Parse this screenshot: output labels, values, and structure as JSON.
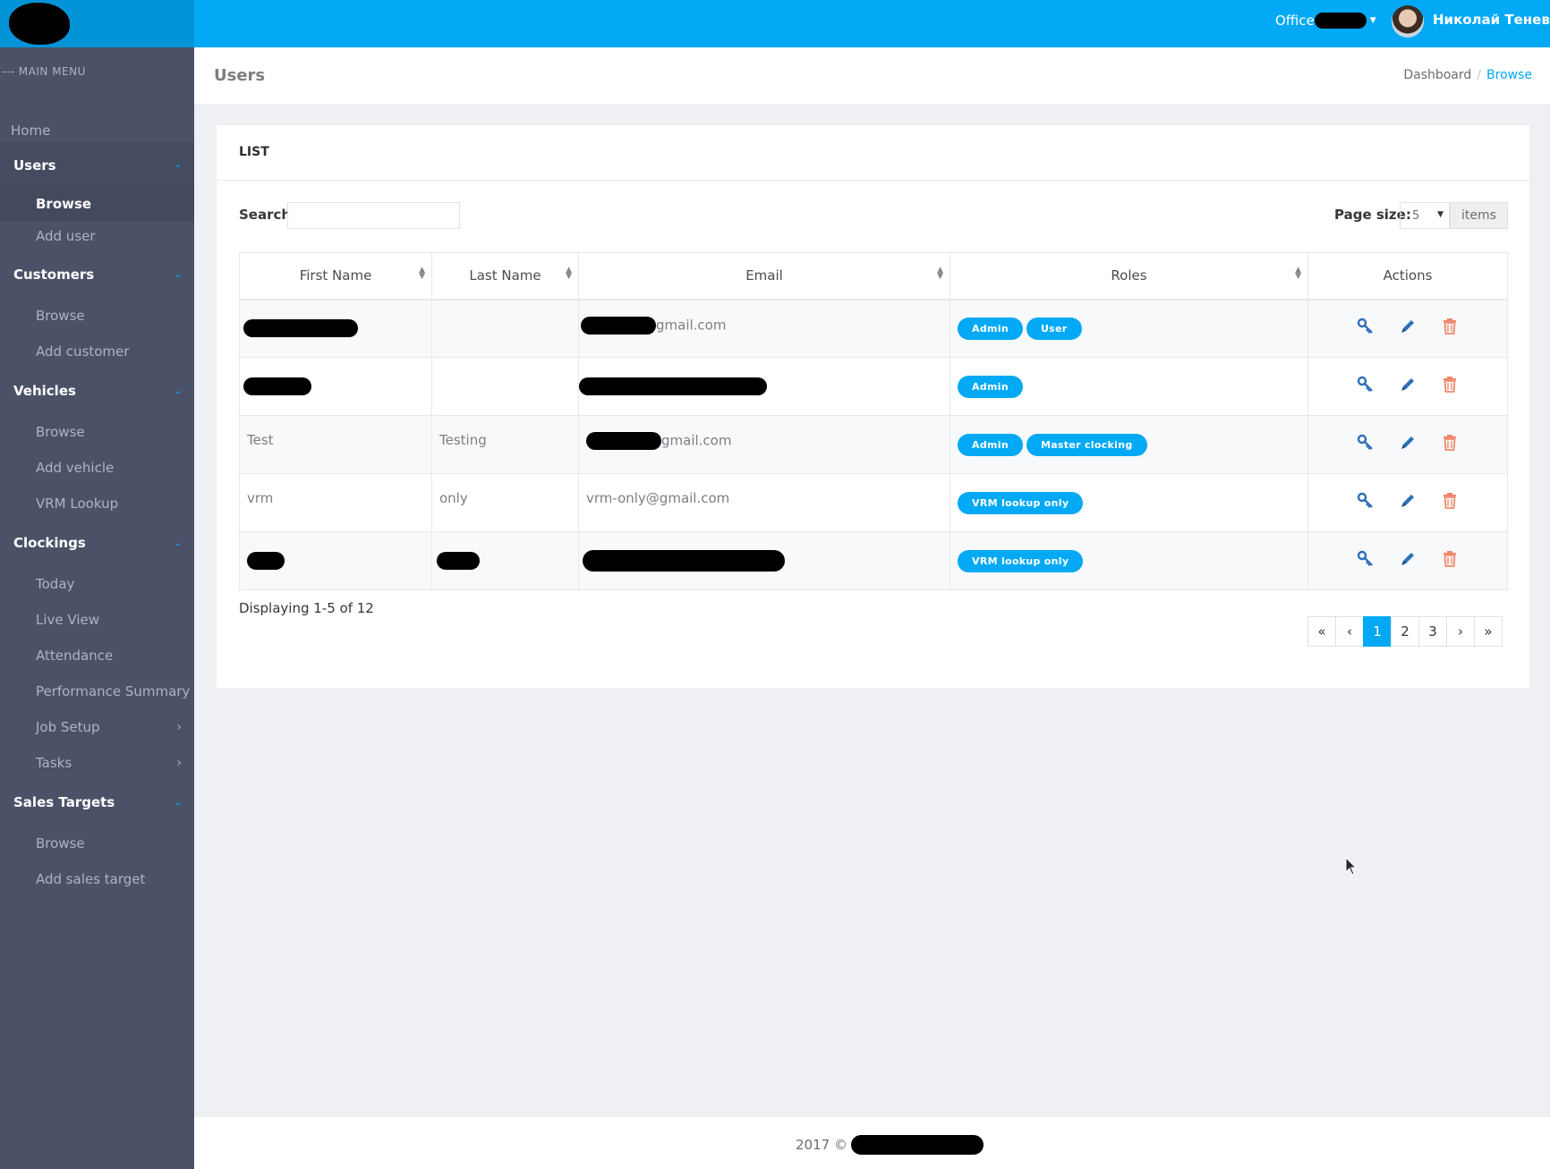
{
  "header": {
    "office_label": "Office",
    "user_name": "Николай Тенев"
  },
  "sidebar": {
    "menu_title": "--- MAIN MENU",
    "home": "Home",
    "users": {
      "label": "Users",
      "items": [
        "Browse",
        "Add user"
      ]
    },
    "customers": {
      "label": "Customers",
      "items": [
        "Browse",
        "Add customer"
      ]
    },
    "vehicles": {
      "label": "Vehicles",
      "items": [
        "Browse",
        "Add vehicle",
        "VRM Lookup"
      ]
    },
    "clockings": {
      "label": "Clockings",
      "items": [
        "Today",
        "Live View",
        "Attendance",
        "Performance Summary",
        "Job Setup",
        "Tasks"
      ]
    },
    "sales_targets": {
      "label": "Sales Targets",
      "items": [
        "Browse",
        "Add sales target"
      ]
    }
  },
  "page": {
    "title": "Users",
    "breadcrumb": [
      "Dashboard",
      "Browse"
    ]
  },
  "panel": {
    "title": "LIST",
    "search_label": "Search:",
    "page_size_label": "Page size:",
    "page_size_value": "5",
    "items_label": "items",
    "columns": [
      "First Name",
      "Last Name",
      "Email",
      "Roles",
      "Actions"
    ],
    "rows": [
      {
        "first": "",
        "last": "",
        "email": "gmail.com",
        "roles": [
          "Admin",
          "User"
        ]
      },
      {
        "first": "",
        "last": "",
        "email": "",
        "roles": [
          "Admin"
        ]
      },
      {
        "first": "Test",
        "last": "Testing",
        "email": "gmail.com",
        "roles": [
          "Admin",
          "Master clocking"
        ]
      },
      {
        "first": "vrm",
        "last": "only",
        "email": "vrm-only@gmail.com",
        "roles": [
          "VRM lookup only"
        ]
      },
      {
        "first": "",
        "last": "",
        "email": "",
        "roles": [
          "VRM lookup only"
        ]
      }
    ],
    "displaying": "Displaying 1-5 of 12",
    "pager": {
      "first": "«",
      "prev": "‹",
      "pages": [
        "1",
        "2",
        "3"
      ],
      "current": "1",
      "next": "›",
      "last": "»"
    }
  },
  "footer": {
    "text": "2017 ©"
  },
  "colors": {
    "primary": "#03a9f4",
    "sidebar": "#4b5267",
    "delete": "#f0876a",
    "action_blue": "#2f6fb8"
  },
  "icons": [
    "key-icon",
    "pencil-icon",
    "trash-icon",
    "chevron-down-icon",
    "chevron-right-icon",
    "sort-icon"
  ]
}
